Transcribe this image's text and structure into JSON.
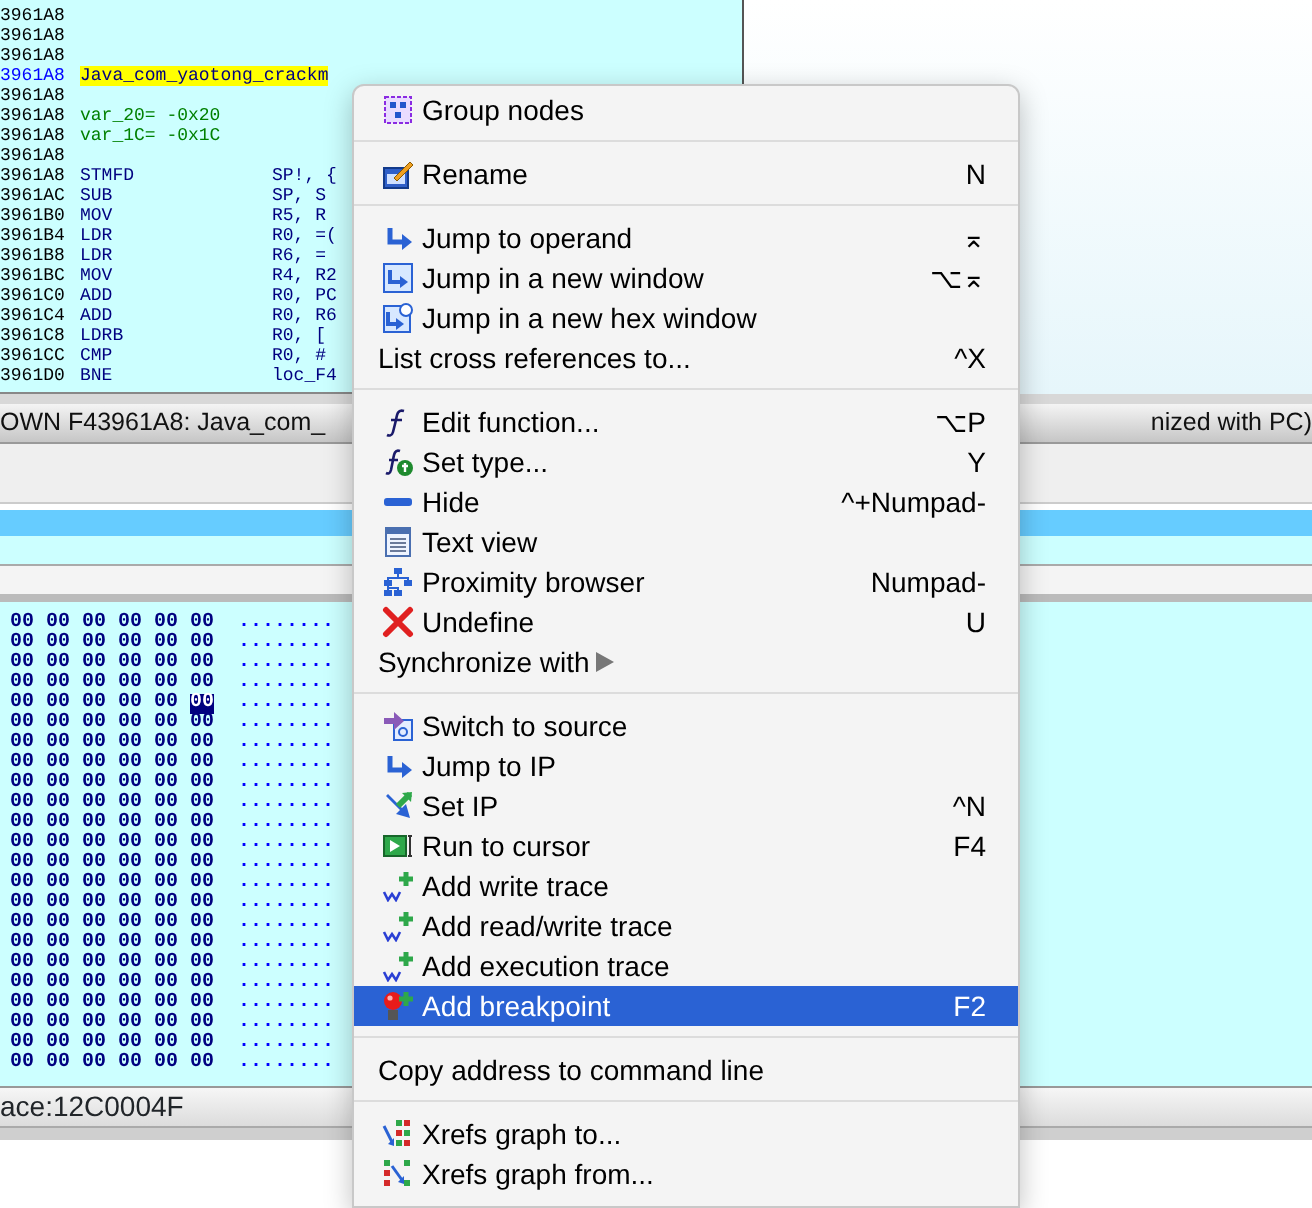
{
  "code_lines": [
    {
      "address": "3961A8",
      "kind": "blank"
    },
    {
      "address": "3961A8",
      "kind": "blank"
    },
    {
      "address": "3961A8",
      "kind": "blank"
    },
    {
      "address": "3961A8",
      "kind": "label",
      "text": "Java_com_yaotong_crackm"
    },
    {
      "address": "3961A8",
      "kind": "blank"
    },
    {
      "address": "3961A8",
      "kind": "var",
      "text": "var_20= -0x20"
    },
    {
      "address": "3961A8",
      "kind": "var",
      "text": "var_1C= -0x1C"
    },
    {
      "address": "3961A8",
      "kind": "blank"
    },
    {
      "address": "3961A8",
      "kind": "insn",
      "mnemonic": "STMFD",
      "operand": "SP!, {"
    },
    {
      "address": "3961AC",
      "kind": "insn",
      "mnemonic": "SUB",
      "operand": "SP, S"
    },
    {
      "address": "3961B0",
      "kind": "insn",
      "mnemonic": "MOV",
      "operand": "R5, R"
    },
    {
      "address": "3961B4",
      "kind": "insn",
      "mnemonic": "LDR",
      "operand": "R0, =("
    },
    {
      "address": "3961B8",
      "kind": "insn",
      "mnemonic": "LDR",
      "operand": "R6, ="
    },
    {
      "address": "3961BC",
      "kind": "insn",
      "mnemonic": "MOV",
      "operand": "R4, R2"
    },
    {
      "address": "3961C0",
      "kind": "insn",
      "mnemonic": "ADD",
      "operand": "R0, PC"
    },
    {
      "address": "3961C4",
      "kind": "insn",
      "mnemonic": "ADD",
      "operand": "R0, R6"
    },
    {
      "address": "3961C8",
      "kind": "insn",
      "mnemonic": "LDRB",
      "operand": "R0, ["
    },
    {
      "address": "3961CC",
      "kind": "insn",
      "mnemonic": "CMP",
      "operand": "R0, #"
    },
    {
      "address": "3961D0",
      "kind": "insn",
      "mnemonic": "BNE",
      "operand": "loc_F4"
    }
  ],
  "sync_status": {
    "left": "OWN F43961A8: Java_com_",
    "right": "nized with PC)"
  },
  "hex_rows": [
    {
      "bytes": [
        {
          "t": "00",
          "selected": false
        },
        {
          "t": "00",
          "selected": false
        },
        {
          "t": "00",
          "selected": false
        },
        {
          "t": "00",
          "selected": false
        },
        {
          "t": "00",
          "selected": false
        },
        {
          "t": "00",
          "selected": false
        }
      ],
      "ascii": "........"
    },
    {
      "bytes": [
        {
          "t": "00",
          "selected": false
        },
        {
          "t": "00",
          "selected": false
        },
        {
          "t": "00",
          "selected": false
        },
        {
          "t": "00",
          "selected": false
        },
        {
          "t": "00",
          "selected": false
        },
        {
          "t": "00",
          "selected": false
        }
      ],
      "ascii": "........"
    },
    {
      "bytes": [
        {
          "t": "00",
          "selected": false
        },
        {
          "t": "00",
          "selected": false
        },
        {
          "t": "00",
          "selected": false
        },
        {
          "t": "00",
          "selected": false
        },
        {
          "t": "00",
          "selected": false
        },
        {
          "t": "00",
          "selected": false
        }
      ],
      "ascii": "........"
    },
    {
      "bytes": [
        {
          "t": "00",
          "selected": false
        },
        {
          "t": "00",
          "selected": false
        },
        {
          "t": "00",
          "selected": false
        },
        {
          "t": "00",
          "selected": false
        },
        {
          "t": "00",
          "selected": false
        },
        {
          "t": "00",
          "selected": false
        }
      ],
      "ascii": "........"
    },
    {
      "bytes": [
        {
          "t": "00",
          "selected": false
        },
        {
          "t": "00",
          "selected": false
        },
        {
          "t": "00",
          "selected": false
        },
        {
          "t": "00",
          "selected": false
        },
        {
          "t": "00",
          "selected": false
        },
        {
          "t": "00",
          "selected": true
        }
      ],
      "ascii": "........"
    },
    {
      "bytes": [
        {
          "t": "00",
          "selected": false
        },
        {
          "t": "00",
          "selected": false
        },
        {
          "t": "00",
          "selected": false
        },
        {
          "t": "00",
          "selected": false
        },
        {
          "t": "00",
          "selected": false
        },
        {
          "t": "00",
          "selected": false
        }
      ],
      "ascii": "........"
    },
    {
      "bytes": [
        {
          "t": "00",
          "selected": false
        },
        {
          "t": "00",
          "selected": false
        },
        {
          "t": "00",
          "selected": false
        },
        {
          "t": "00",
          "selected": false
        },
        {
          "t": "00",
          "selected": false
        },
        {
          "t": "00",
          "selected": false
        }
      ],
      "ascii": "........"
    },
    {
      "bytes": [
        {
          "t": "00",
          "selected": false
        },
        {
          "t": "00",
          "selected": false
        },
        {
          "t": "00",
          "selected": false
        },
        {
          "t": "00",
          "selected": false
        },
        {
          "t": "00",
          "selected": false
        },
        {
          "t": "00",
          "selected": false
        }
      ],
      "ascii": "........"
    },
    {
      "bytes": [
        {
          "t": "00",
          "selected": false
        },
        {
          "t": "00",
          "selected": false
        },
        {
          "t": "00",
          "selected": false
        },
        {
          "t": "00",
          "selected": false
        },
        {
          "t": "00",
          "selected": false
        },
        {
          "t": "00",
          "selected": false
        }
      ],
      "ascii": "........"
    },
    {
      "bytes": [
        {
          "t": "00",
          "selected": false
        },
        {
          "t": "00",
          "selected": false
        },
        {
          "t": "00",
          "selected": false
        },
        {
          "t": "00",
          "selected": false
        },
        {
          "t": "00",
          "selected": false
        },
        {
          "t": "00",
          "selected": false
        }
      ],
      "ascii": "........"
    },
    {
      "bytes": [
        {
          "t": "00",
          "selected": false
        },
        {
          "t": "00",
          "selected": false
        },
        {
          "t": "00",
          "selected": false
        },
        {
          "t": "00",
          "selected": false
        },
        {
          "t": "00",
          "selected": false
        },
        {
          "t": "00",
          "selected": false
        }
      ],
      "ascii": "........"
    },
    {
      "bytes": [
        {
          "t": "00",
          "selected": false
        },
        {
          "t": "00",
          "selected": false
        },
        {
          "t": "00",
          "selected": false
        },
        {
          "t": "00",
          "selected": false
        },
        {
          "t": "00",
          "selected": false
        },
        {
          "t": "00",
          "selected": false
        }
      ],
      "ascii": "........"
    },
    {
      "bytes": [
        {
          "t": "00",
          "selected": false
        },
        {
          "t": "00",
          "selected": false
        },
        {
          "t": "00",
          "selected": false
        },
        {
          "t": "00",
          "selected": false
        },
        {
          "t": "00",
          "selected": false
        },
        {
          "t": "00",
          "selected": false
        }
      ],
      "ascii": "........"
    },
    {
      "bytes": [
        {
          "t": "00",
          "selected": false
        },
        {
          "t": "00",
          "selected": false
        },
        {
          "t": "00",
          "selected": false
        },
        {
          "t": "00",
          "selected": false
        },
        {
          "t": "00",
          "selected": false
        },
        {
          "t": "00",
          "selected": false
        }
      ],
      "ascii": "........"
    },
    {
      "bytes": [
        {
          "t": "00",
          "selected": false
        },
        {
          "t": "00",
          "selected": false
        },
        {
          "t": "00",
          "selected": false
        },
        {
          "t": "00",
          "selected": false
        },
        {
          "t": "00",
          "selected": false
        },
        {
          "t": "00",
          "selected": false
        }
      ],
      "ascii": "........"
    },
    {
      "bytes": [
        {
          "t": "00",
          "selected": false
        },
        {
          "t": "00",
          "selected": false
        },
        {
          "t": "00",
          "selected": false
        },
        {
          "t": "00",
          "selected": false
        },
        {
          "t": "00",
          "selected": false
        },
        {
          "t": "00",
          "selected": false
        }
      ],
      "ascii": "........"
    },
    {
      "bytes": [
        {
          "t": "00",
          "selected": false
        },
        {
          "t": "00",
          "selected": false
        },
        {
          "t": "00",
          "selected": false
        },
        {
          "t": "00",
          "selected": false
        },
        {
          "t": "00",
          "selected": false
        },
        {
          "t": "00",
          "selected": false
        }
      ],
      "ascii": "........"
    },
    {
      "bytes": [
        {
          "t": "00",
          "selected": false
        },
        {
          "t": "00",
          "selected": false
        },
        {
          "t": "00",
          "selected": false
        },
        {
          "t": "00",
          "selected": false
        },
        {
          "t": "00",
          "selected": false
        },
        {
          "t": "00",
          "selected": false
        }
      ],
      "ascii": "........"
    },
    {
      "bytes": [
        {
          "t": "00",
          "selected": false
        },
        {
          "t": "00",
          "selected": false
        },
        {
          "t": "00",
          "selected": false
        },
        {
          "t": "00",
          "selected": false
        },
        {
          "t": "00",
          "selected": false
        },
        {
          "t": "00",
          "selected": false
        }
      ],
      "ascii": "........"
    },
    {
      "bytes": [
        {
          "t": "00",
          "selected": false
        },
        {
          "t": "00",
          "selected": false
        },
        {
          "t": "00",
          "selected": false
        },
        {
          "t": "00",
          "selected": false
        },
        {
          "t": "00",
          "selected": false
        },
        {
          "t": "00",
          "selected": false
        }
      ],
      "ascii": "........"
    },
    {
      "bytes": [
        {
          "t": "00",
          "selected": false
        },
        {
          "t": "00",
          "selected": false
        },
        {
          "t": "00",
          "selected": false
        },
        {
          "t": "00",
          "selected": false
        },
        {
          "t": "00",
          "selected": false
        },
        {
          "t": "00",
          "selected": false
        }
      ],
      "ascii": "........"
    },
    {
      "bytes": [
        {
          "t": "00",
          "selected": false
        },
        {
          "t": "00",
          "selected": false
        },
        {
          "t": "00",
          "selected": false
        },
        {
          "t": "00",
          "selected": false
        },
        {
          "t": "00",
          "selected": false
        },
        {
          "t": "00",
          "selected": false
        }
      ],
      "ascii": "........"
    },
    {
      "bytes": [
        {
          "t": "00",
          "selected": false
        },
        {
          "t": "00",
          "selected": false
        },
        {
          "t": "00",
          "selected": false
        },
        {
          "t": "00",
          "selected": false
        },
        {
          "t": "00",
          "selected": false
        },
        {
          "t": "00",
          "selected": false
        }
      ],
      "ascii": "........"
    }
  ],
  "hex_status": "ace:12C0004F",
  "context_menu": [
    {
      "kind": "group",
      "label": "Group nodes",
      "selected": false
    },
    {
      "kind": "separator"
    },
    {
      "kind": "rename",
      "label": "Rename",
      "shortcut": "N",
      "selected": false
    },
    {
      "kind": "separator"
    },
    {
      "kind": "jump",
      "label": "Jump to operand",
      "shortcut": "⌅",
      "selected": false
    },
    {
      "kind": "window",
      "label": "Jump in a new window",
      "shortcut": "⌥⌅",
      "selected": false
    },
    {
      "kind": "hexwindow",
      "label": "Jump in a new hex window",
      "selected": false
    },
    {
      "kind": "plain",
      "label": "List cross references to...",
      "shortcut": "^X",
      "selected": false
    },
    {
      "kind": "separator"
    },
    {
      "kind": "function",
      "label": "Edit function...",
      "shortcut": "⌥P",
      "selected": false
    },
    {
      "kind": "settype",
      "label": "Set type...",
      "shortcut": "Y",
      "selected": false
    },
    {
      "kind": "hide",
      "label": "Hide",
      "shortcut": "^+Numpad-",
      "selected": false
    },
    {
      "kind": "textview",
      "label": "Text view",
      "selected": false
    },
    {
      "kind": "proximity",
      "label": "Proximity browser",
      "shortcut": "Numpad-",
      "selected": false
    },
    {
      "kind": "undefine",
      "label": "Undefine",
      "shortcut": "U",
      "selected": false
    },
    {
      "kind": "plain",
      "label": "Synchronize with",
      "submenu": true,
      "selected": false
    },
    {
      "kind": "separator"
    },
    {
      "kind": "source",
      "label": "Switch to source",
      "selected": false
    },
    {
      "kind": "jump",
      "label": "Jump to IP",
      "selected": false
    },
    {
      "kind": "setip",
      "label": "Set IP",
      "shortcut": "^N",
      "selected": false
    },
    {
      "kind": "runcursor",
      "label": "Run to cursor",
      "shortcut": "F4",
      "selected": false
    },
    {
      "kind": "trace",
      "label": "Add write trace",
      "selected": false
    },
    {
      "kind": "trace",
      "label": "Add read/write trace",
      "selected": false
    },
    {
      "kind": "trace",
      "label": "Add execution trace",
      "selected": false
    },
    {
      "kind": "breakpoint",
      "label": "Add breakpoint",
      "shortcut": "F2",
      "selected": true
    },
    {
      "kind": "separator"
    },
    {
      "kind": "plain",
      "label": "Copy address to command line",
      "selected": false
    },
    {
      "kind": "separator"
    },
    {
      "kind": "xrefsto",
      "label": "Xrefs graph to...",
      "selected": false
    },
    {
      "kind": "xrefsfrom",
      "label": "Xrefs graph from...",
      "selected": false
    }
  ]
}
